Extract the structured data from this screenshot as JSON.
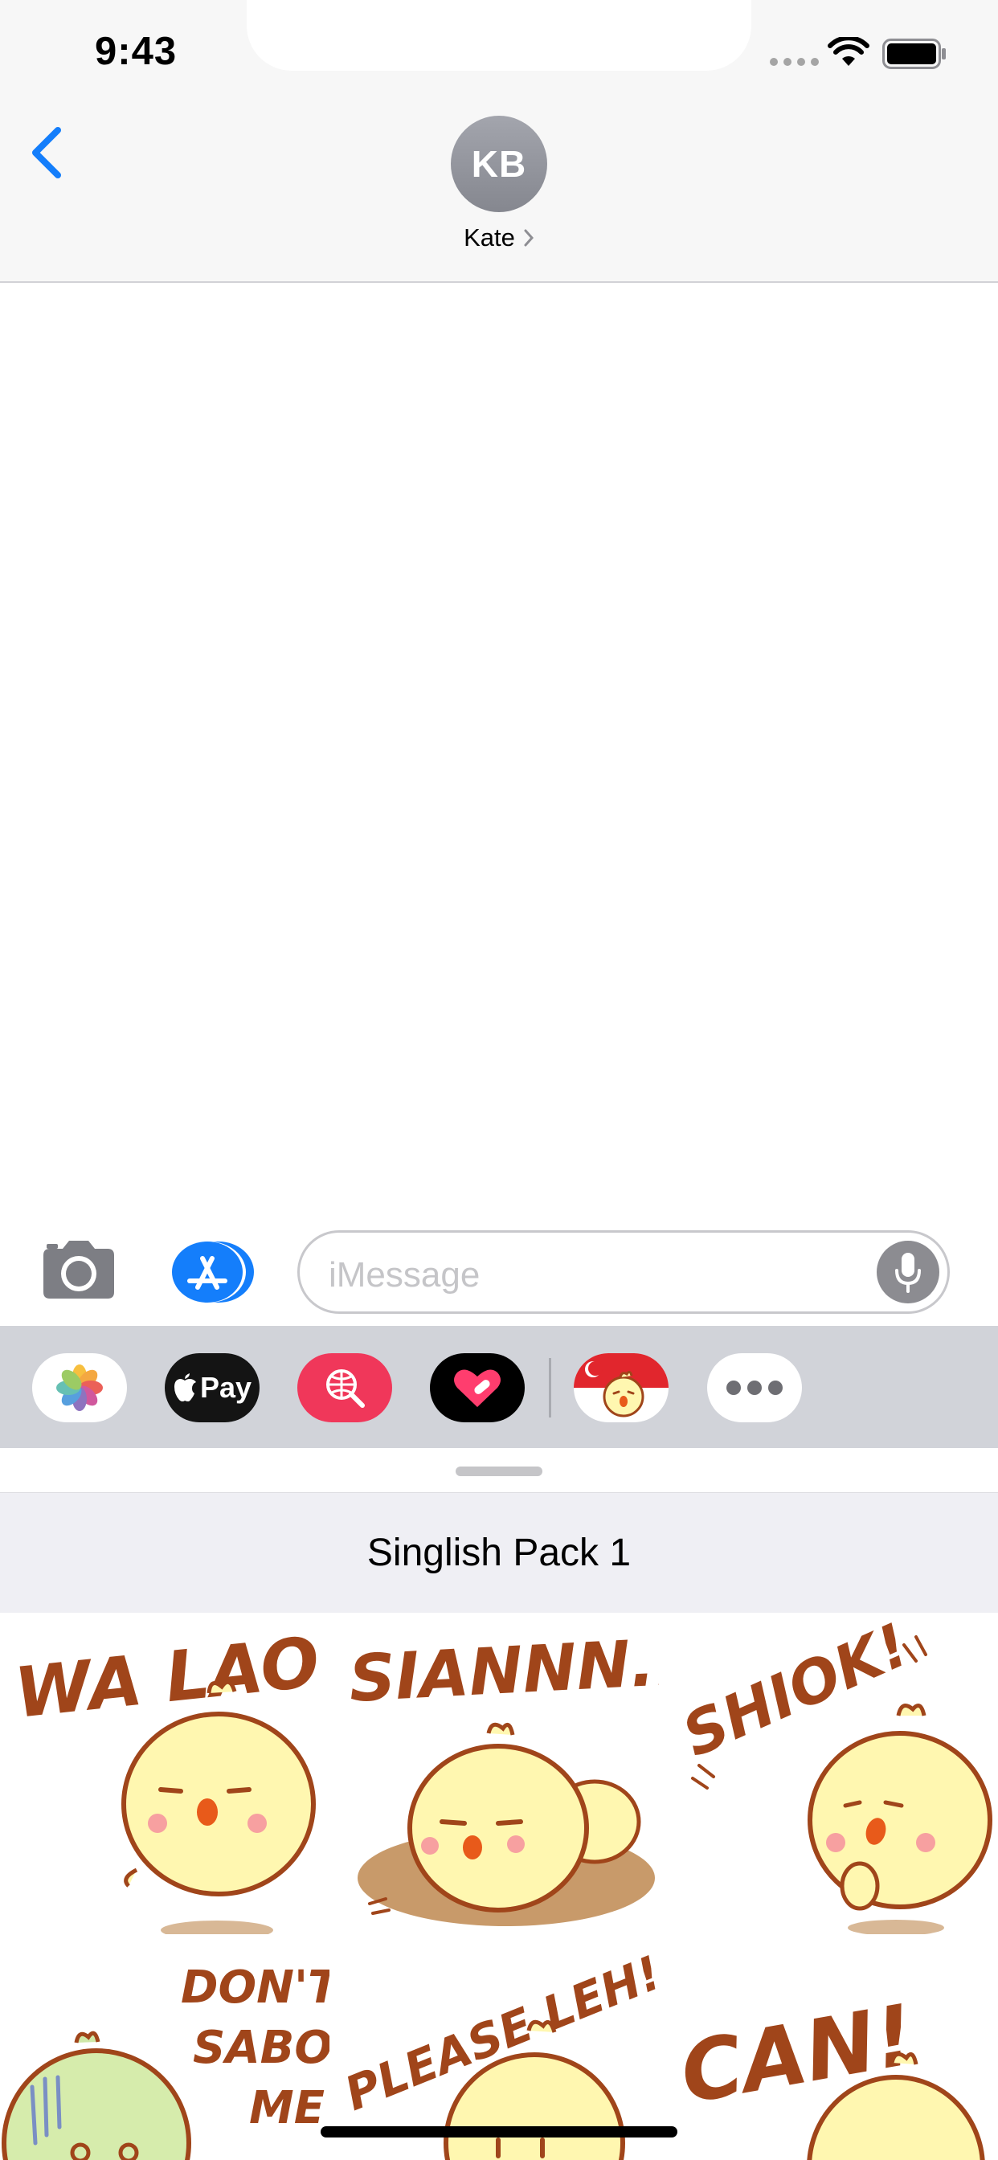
{
  "status_bar": {
    "time": "9:43"
  },
  "header": {
    "contact_initials": "KB",
    "contact_name": "Kate"
  },
  "icons": {
    "back": "chevron-left-icon",
    "camera": "camera-icon",
    "app_store": "app-store-icon",
    "microphone": "microphone-icon",
    "wifi": "wifi-icon",
    "battery": "battery-icon"
  },
  "compose": {
    "placeholder": "iMessage"
  },
  "app_strip": {
    "apps": [
      "Photos",
      "Apple Pay",
      "Search",
      "Digital Touch",
      "Singlish Stickers",
      "More"
    ],
    "apple_pay_label": "Pay"
  },
  "sticker_panel": {
    "title": "Singlish Pack 1",
    "stickers": [
      {
        "text": "WA LAO"
      },
      {
        "text": "SIANNN.."
      },
      {
        "text": "SHIOK!"
      },
      {
        "line1": "DON'T",
        "line2": "SABO",
        "line3": "ME"
      },
      {
        "text": "PLEASE LEH!"
      },
      {
        "text": "CAN!"
      }
    ]
  },
  "colors": {
    "accent_blue": "#147efb",
    "sticker_brown": "#a0451a",
    "chick_yellow": "#fff7b0",
    "header_bg": "#f7f7f7",
    "app_strip_bg": "#d1d3d9"
  }
}
